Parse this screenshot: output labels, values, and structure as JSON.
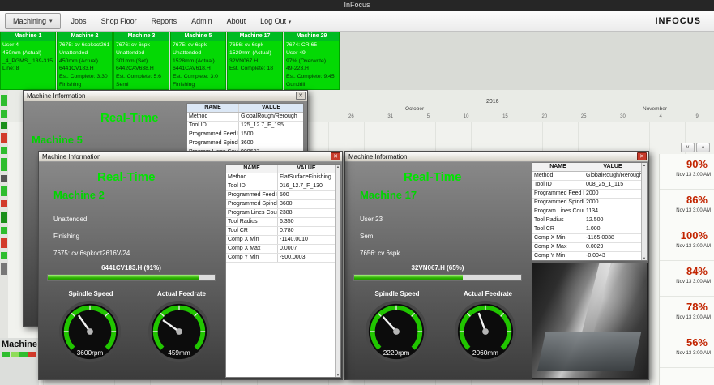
{
  "titlebar": {
    "title": "InFocus"
  },
  "menubar": {
    "items": [
      {
        "label": "Machining"
      },
      {
        "label": "Jobs"
      },
      {
        "label": "Shop Floor"
      },
      {
        "label": "Reports"
      },
      {
        "label": "Admin"
      },
      {
        "label": "About"
      },
      {
        "label": "Log Out"
      }
    ],
    "brand": "INFOCUS"
  },
  "icons": {
    "close": "✕",
    "dropdown": "▾",
    "chev_up": "˄",
    "chev_down": "˅",
    "sb_up": "▲",
    "sb_down": "▼"
  },
  "theme": {
    "ok_green": "#04d904",
    "alert_red": "#c22400",
    "realtime_green": "#00e400"
  },
  "cards": [
    {
      "title": "Machine 1",
      "lines": [
        "User 4",
        "450mm (Actual)",
        "_4_PGMS_.139-315.H",
        "Line: 8",
        "",
        ""
      ]
    },
    {
      "title": "Machine 2",
      "lines": [
        "7675: cv 6spkoct261",
        "Unattended",
        "450mm (Actual)",
        "6441CV183.H",
        "Est. Complete: 3:30",
        "Finishing"
      ]
    },
    {
      "title": "Machine 3",
      "lines": [
        "7676: cv 6spk",
        "Unattended",
        "301mm (Set)",
        "6442CAV638.H",
        "Est. Complete: 5:6",
        "Semi"
      ]
    },
    {
      "title": "Machine 5",
      "lines": [
        "7675: cv 6spk",
        "Unattended",
        "1528mm (Actual)",
        "6441CAV618.H",
        "Est. Complete: 3:0",
        "Finishing"
      ]
    },
    {
      "title": "Machine 17",
      "lines": [
        "7656: cv 6spk",
        "1529mm (Actual)",
        "32VN067.H",
        "Est. Complete: 18",
        "",
        ""
      ]
    },
    {
      "title": "Machine 29",
      "lines": [
        "7674: CR 65",
        "User 49",
        "97% (Overwrite)",
        "49-223.H",
        "Est. Complete: 9:45",
        "Gundrill"
      ]
    }
  ],
  "timeline": {
    "year": "2016",
    "month_left": "October",
    "month_right": "November",
    "days": [
      "26",
      "31",
      "5",
      "10",
      "15",
      "20",
      "25",
      "30",
      "4",
      "9"
    ]
  },
  "kpis": [
    {
      "value": "90%",
      "time": "Nov 13 3:00 AM"
    },
    {
      "value": "86%",
      "time": "Nov 13 3:00 AM"
    },
    {
      "value": "100%",
      "time": "Nov 13 3:00 AM"
    },
    {
      "value": "84%",
      "time": "Nov 13 3:00 AM"
    },
    {
      "value": "78%",
      "time": "Nov 13 3:00 AM"
    },
    {
      "value": "56%",
      "time": "Nov 13 3:00 AM"
    }
  ],
  "status_strip": [
    "#2ebd2e",
    "#2ebd2e",
    "#1b8f1b",
    "#d23b2b",
    "#2ebd2e",
    "#2ebd2e",
    "#555555",
    "#2ebd2e",
    "#d23b2b",
    "#1b8f1b",
    "#2ebd2e",
    "#d23b2b",
    "#2ebd2e",
    "#777777"
  ],
  "bottom": {
    "label": "Machine"
  },
  "bottom_strip": [
    "#2ebd2e",
    "#8fdc5a",
    "#2ebd2e",
    "#d23b2b"
  ],
  "table_headers": {
    "name": "NAME",
    "value": "VALUE"
  },
  "dialog_back": {
    "title": "Machine Information",
    "realtime": "Real-Time",
    "machine": "Machine 5",
    "table": [
      {
        "name": "Method",
        "value": "GlobalRough/Rerough"
      },
      {
        "name": "Tool ID",
        "value": "125_12.7_F_195"
      },
      {
        "name": "Programmed Feed Rate",
        "value": "1500"
      },
      {
        "name": "Programmed Spindle Speed",
        "value": "3600"
      },
      {
        "name": "Program Lines Count",
        "value": "909697"
      }
    ]
  },
  "dialog_left": {
    "title": "Machine Information",
    "realtime": "Real-Time",
    "machine": "Machine 2",
    "status": "Unattended",
    "mode": "Finishing",
    "tool": "7675: cv 6spkoct2616V/24",
    "progress": {
      "label": "6441CV183.H (91%)",
      "percent": 91
    },
    "gauges": {
      "spindle_label": "Spindle Speed",
      "feed_label": "Actual Feedrate",
      "spindle_value": "3600rpm",
      "feed_value": "459mm"
    },
    "table": [
      {
        "name": "Method",
        "value": "FlatSurfaceFinishing"
      },
      {
        "name": "Tool ID",
        "value": "016_12.7_F_130"
      },
      {
        "name": "Programmed Feed Rate",
        "value": "500"
      },
      {
        "name": "Programmed Spindle Speed",
        "value": "3600"
      },
      {
        "name": "Program Lines Count",
        "value": "2388"
      },
      {
        "name": "Tool Radius",
        "value": "6.350"
      },
      {
        "name": "Tool CR",
        "value": "0.780"
      },
      {
        "name": "Comp X Min",
        "value": "-1140.0010"
      },
      {
        "name": "Comp X Max",
        "value": "0.0007"
      },
      {
        "name": "Comp Y Min",
        "value": "-900.0003"
      }
    ]
  },
  "dialog_right": {
    "title": "Machine Information",
    "realtime": "Real-Time",
    "machine": "Machine 17",
    "status": "User 23",
    "mode": "Semi",
    "tool": "7656: cv 6spk",
    "progress": {
      "label": "32VN067.H (65%)",
      "percent": 65
    },
    "gauges": {
      "spindle_label": "Spindle Speed",
      "feed_label": "Actual Feedrate",
      "spindle_value": "2220rpm",
      "feed_value": "2060mm"
    },
    "table": [
      {
        "name": "Method",
        "value": "GlobalRough/Rerough"
      },
      {
        "name": "Tool ID",
        "value": "008_25_1_115"
      },
      {
        "name": "Programmed Feed Rate",
        "value": "2000"
      },
      {
        "name": "Programmed Spindle Speed",
        "value": "2000"
      },
      {
        "name": "Program Lines Count",
        "value": "1134"
      },
      {
        "name": "Tool Radius",
        "value": "12.500"
      },
      {
        "name": "Tool CR",
        "value": "1.000"
      },
      {
        "name": "Comp X Min",
        "value": "-1165.0038"
      },
      {
        "name": "Comp X Max",
        "value": "0.0029"
      },
      {
        "name": "Comp Y Min",
        "value": "-0.0043"
      }
    ]
  }
}
